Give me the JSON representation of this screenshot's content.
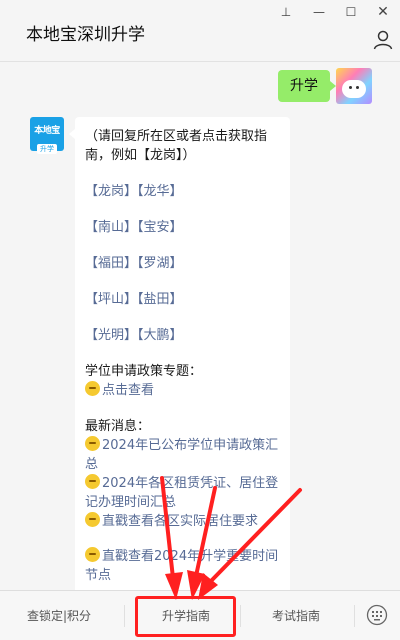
{
  "window": {
    "title": "本地宝深圳升学",
    "controls": {
      "pin": "⊥",
      "minimize": "—",
      "maximize": "☐",
      "close": "✕"
    }
  },
  "chat": {
    "outgoing_message": "升学",
    "bot_avatar": {
      "line1": "本地宝",
      "line2": "升学"
    },
    "reply": {
      "intro": "（请回复所在区或者点击获取指南，例如【龙岗】）",
      "districts": [
        [
          "【龙岗】",
          "【龙华】"
        ],
        [
          "【南山】",
          "【宝安】"
        ],
        [
          "【福田】",
          "【罗湖】"
        ],
        [
          "【坪山】",
          "【盐田】"
        ],
        [
          "【光明】",
          "【大鹏】"
        ]
      ],
      "policy_heading": "学位申请政策专题：",
      "policy_link": "点击查看",
      "news_heading": "最新消息：",
      "news_items": [
        "2024年已公布学位申请政策汇总",
        "2024年各区租赁凭证、居住登记办理时间汇总",
        "直戳查看各区实际居住要求",
        "直戳查看2024年升学重要时间节点"
      ]
    }
  },
  "bottom_menu": {
    "items": [
      "查锁定|积分",
      "升学指南",
      "考试指南"
    ]
  },
  "colors": {
    "link": "#576b95",
    "outgoing_bubble": "#95ec69",
    "highlight": "#ff2020"
  }
}
